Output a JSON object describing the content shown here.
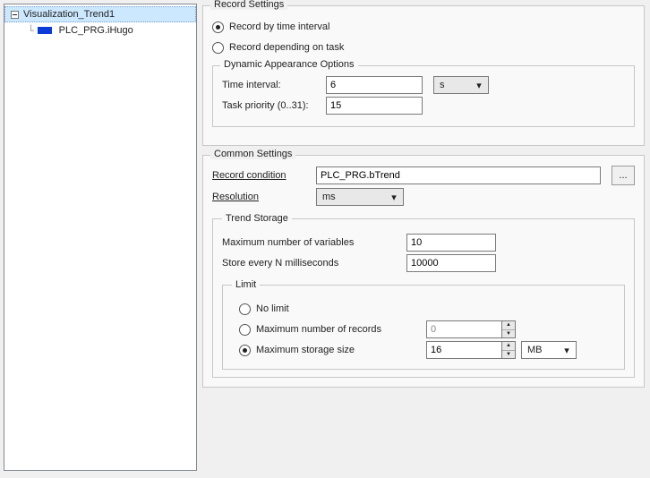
{
  "tree": {
    "root": "Visualization_Trend1",
    "child": "PLC_PRG.iHugo"
  },
  "record_settings": {
    "group_title": "Record Settings",
    "by_interval_label": "Record by time interval",
    "by_interval_selected": true,
    "by_task_label": "Record depending on task",
    "by_task_selected": false
  },
  "dynamic": {
    "group_title": "Dynamic Appearance Options",
    "time_interval_label": "Time interval:",
    "time_interval_value": "6",
    "time_unit": "s",
    "priority_label": "Task priority (0..31):",
    "priority_value": "15"
  },
  "common": {
    "group_title": "Common Settings",
    "record_condition_label": "Record condition",
    "record_condition_value": "PLC_PRG.bTrend",
    "browse_button": "...",
    "resolution_label": "Resolution",
    "resolution_value": "ms"
  },
  "storage": {
    "group_title": "Trend Storage",
    "max_vars_label": "Maximum number of variables",
    "max_vars_value": "10",
    "store_ms_label": "Store every N milliseconds",
    "store_ms_value": "10000",
    "limit": {
      "group_title": "Limit",
      "no_limit_label": "No limit",
      "no_limit_selected": false,
      "max_records_label": "Maximum number of records",
      "max_records_selected": false,
      "max_records_value": "0",
      "max_size_label": "Maximum storage size",
      "max_size_selected": true,
      "max_size_value": "16",
      "size_unit": "MB"
    }
  }
}
